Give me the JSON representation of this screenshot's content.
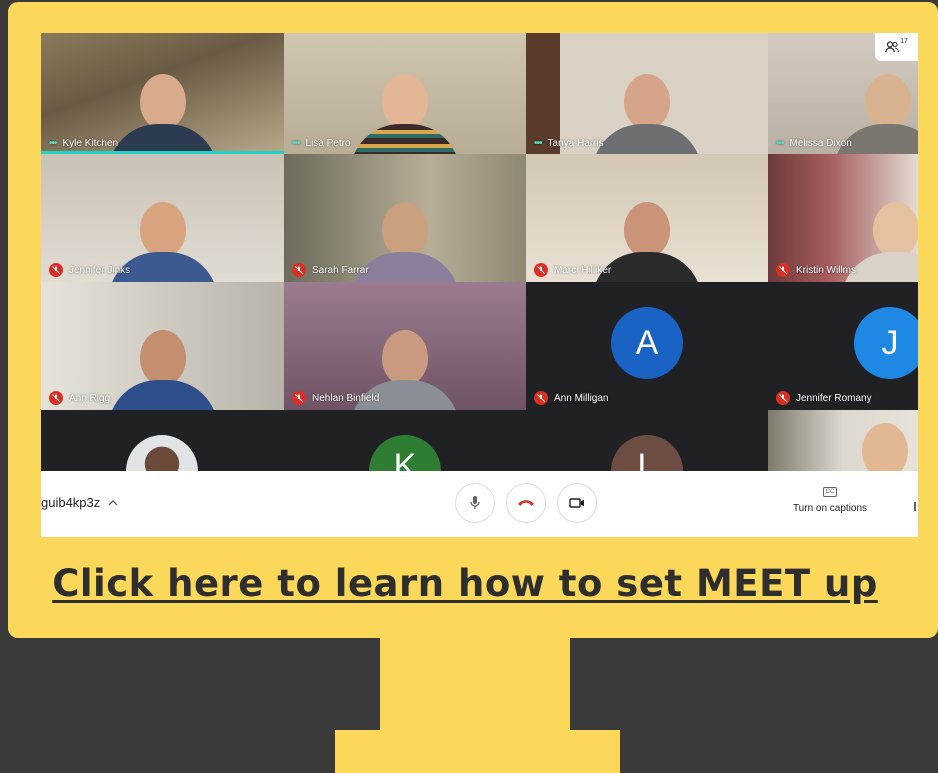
{
  "participants": [
    {
      "name": "Kyle Kitchen",
      "status": "speaking"
    },
    {
      "name": "Lisa Petro",
      "status": "speaking"
    },
    {
      "name": "Tanya Harris",
      "status": "speaking"
    },
    {
      "name": "Melissa Dixon",
      "status": "speaking"
    },
    {
      "name": "Jennifer Jinks",
      "status": "muted"
    },
    {
      "name": "Sarah Farrar",
      "status": "muted"
    },
    {
      "name": "Marci Hilliker",
      "status": "muted"
    },
    {
      "name": "Kristin Willms",
      "status": "muted"
    },
    {
      "name": "Ann Rigg",
      "status": "muted"
    },
    {
      "name": "Nehlan Binfield",
      "status": "muted"
    },
    {
      "name": "Ann Milligan",
      "status": "muted",
      "avatar_letter": "A",
      "avatar_color": "#1a63c4"
    },
    {
      "name": "Jennifer Romany",
      "status": "muted",
      "avatar_letter": "J",
      "avatar_color": "#1e88e5"
    }
  ],
  "partial_row": [
    {
      "avatar_letter": "K",
      "avatar_color": "#2e7d32"
    },
    {
      "avatar_letter": "L",
      "avatar_color": "#6d4c41"
    }
  ],
  "people_count": "17",
  "bottom_bar": {
    "meeting_code": "guib4kp3z",
    "captions_label": "Turn on captions",
    "captions_icon": "CC"
  },
  "link_text": "Click here to learn how to set MEET up",
  "colors": {
    "frame": "#fcd85a",
    "background": "#3a3a3a",
    "end_call": "#d93025",
    "active_speaker": "#22d3c5"
  }
}
